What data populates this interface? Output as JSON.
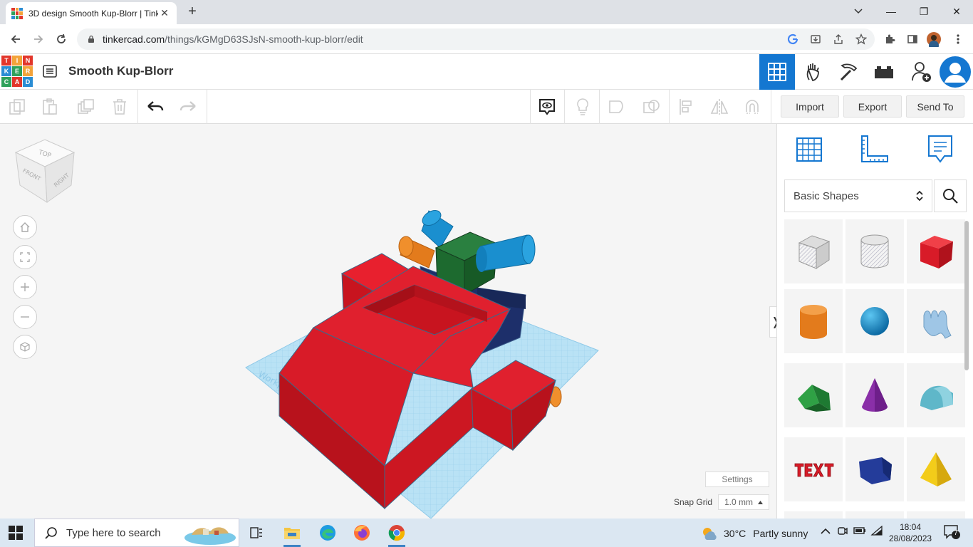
{
  "browser": {
    "tab_title": "3D design Smooth Kup-Blorr | Tinkercad",
    "url_host": "tinkercad.com",
    "url_path": "/things/kGMgD63SJsN-smooth-kup-blorr/edit",
    "new_tab_label": "+",
    "close_tab_label": "✕",
    "minimize_label": "—",
    "restore_label": "❐",
    "close_label": "✕"
  },
  "app": {
    "logo_letters": [
      "T",
      "I",
      "N",
      "K",
      "E",
      "R",
      "C",
      "A",
      "D"
    ],
    "design_title": "Smooth Kup-Blorr"
  },
  "toolbar": {
    "import_label": "Import",
    "export_label": "Export",
    "send_to_label": "Send To"
  },
  "viewcube": {
    "top": "TOP",
    "front": "FRONT",
    "right": "RIGHT"
  },
  "workplane": {
    "settings_label": "Settings",
    "snap_grid_label": "Snap Grid",
    "snap_grid_value": "1.0 mm",
    "collapse_label": "❭",
    "workplane_text": "Workplane"
  },
  "shapes_panel": {
    "category": "Basic Shapes",
    "shapes": [
      "box-hole",
      "cylinder-hole",
      "box",
      "cylinder",
      "sphere",
      "scribble",
      "roof",
      "cone",
      "round-roof",
      "text",
      "half-sphere-hexagon",
      "pyramid"
    ]
  },
  "taskbar": {
    "search_placeholder": "Type here to search",
    "weather_temp": "30°C",
    "weather_desc": "Partly sunny",
    "time": "18:04",
    "date": "28/08/2023",
    "notifications": "7"
  },
  "colors": {
    "accent": "#1477d1",
    "shape_red": "#e0202e",
    "shape_blue": "#1a8fcf",
    "shape_green": "#1d6a2f",
    "shape_navy": "#1d2f6a",
    "shape_orange": "#e37b1c",
    "grid": "#9bd3ef"
  }
}
